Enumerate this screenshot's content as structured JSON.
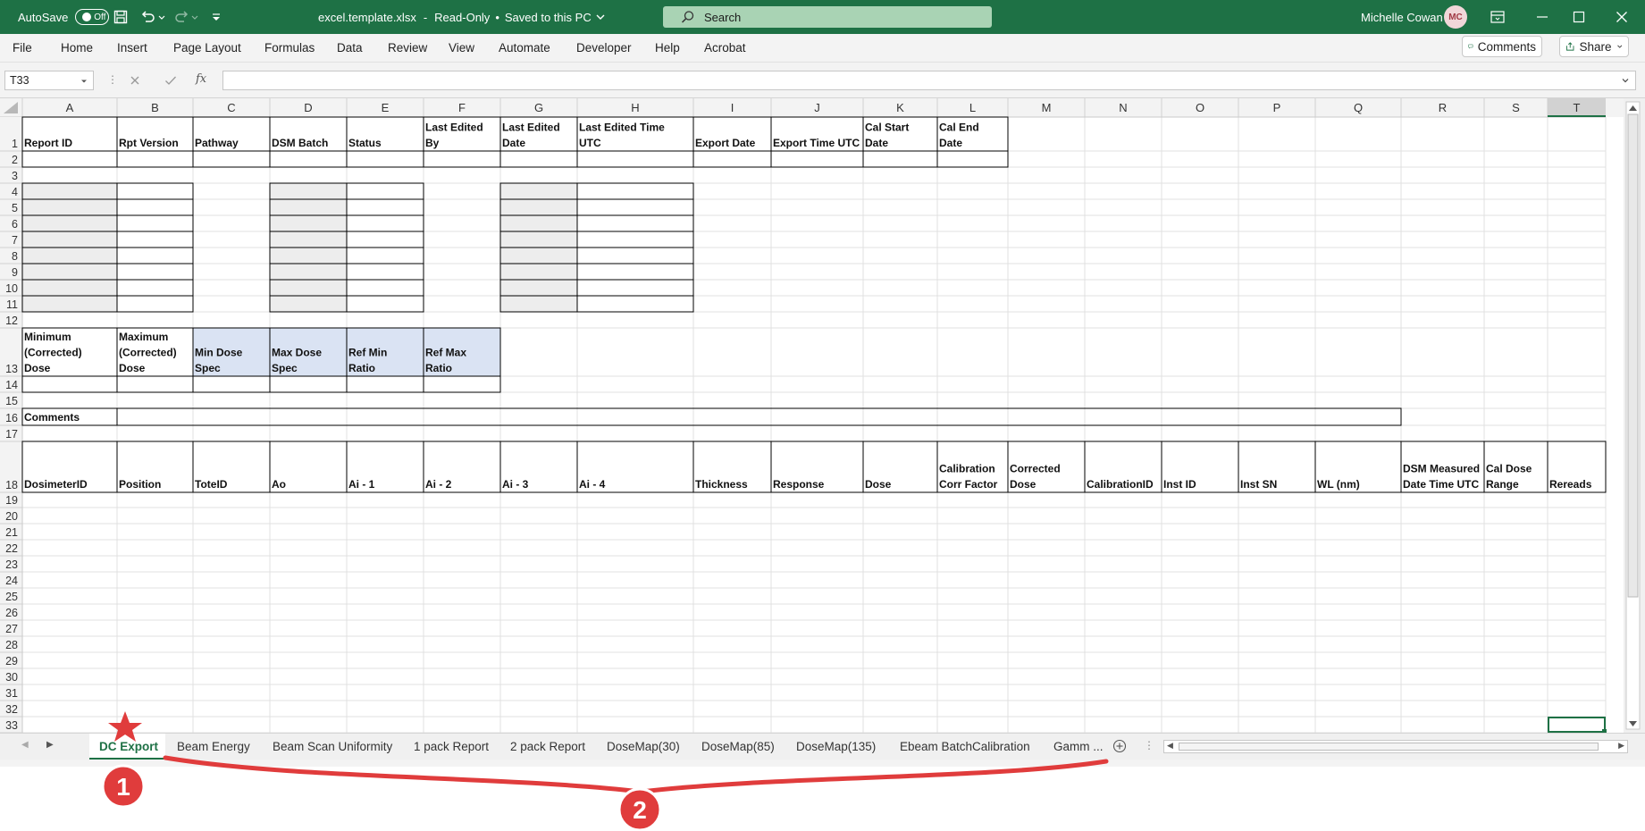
{
  "titlebar": {
    "autosave_label": "AutoSave",
    "autosave_state": "Off",
    "filename": "excel.template.xlsx",
    "status": "Read-Only",
    "saved": "Saved to this PC",
    "search_placeholder": "Search",
    "user_name": "Michelle Cowan",
    "user_initials": "MC"
  },
  "menu": {
    "items": [
      "File",
      "Home",
      "Insert",
      "Page Layout",
      "Formulas",
      "Data",
      "Review",
      "View",
      "Automate",
      "Developer",
      "Help",
      "Acrobat"
    ],
    "comments_label": "Comments",
    "share_label": "Share"
  },
  "formula_bar": {
    "cell_ref": "T33",
    "fx_label": "fx",
    "formula": ""
  },
  "grid": {
    "columns": [
      "A",
      "B",
      "C",
      "D",
      "E",
      "F",
      "G",
      "H",
      "I",
      "J",
      "K",
      "L",
      "M",
      "N",
      "O",
      "P",
      "Q",
      "R",
      "S",
      "T"
    ],
    "rows": [
      "1",
      "2",
      "3",
      "4",
      "5",
      "6",
      "7",
      "8",
      "9",
      "10",
      "11",
      "12",
      "13",
      "14",
      "15",
      "16",
      "17",
      "18",
      "19",
      "20",
      "21",
      "22",
      "23",
      "24",
      "25",
      "26",
      "27",
      "28",
      "29",
      "30",
      "31",
      "32",
      "33"
    ],
    "row1_headers": [
      "Report ID",
      "Rpt Version",
      "Pathway",
      "DSM Batch",
      "Status",
      "Last Edited By",
      "Last Edited Date",
      "Last Edited Time UTC",
      "Export Date",
      "Export Time UTC",
      "Cal Start Date",
      "Cal End Date"
    ],
    "row13_headers": [
      "Minimum (Corrected) Dose",
      "Maximum (Corrected) Dose",
      "Min Dose Spec",
      "Max Dose Spec",
      "Ref Min Ratio",
      "Ref Max Ratio"
    ],
    "row16_label": "Comments",
    "row18_headers": [
      "DosimeterID",
      "Position",
      "ToteID",
      "Ao",
      "Ai - 1",
      "Ai - 2",
      "Ai - 3",
      "Ai - 4",
      "Thickness",
      "Response",
      "Dose",
      "Calibration Corr Factor",
      "Corrected Dose",
      "CalibrationID",
      "Inst ID",
      "Inst SN",
      "WL (nm)",
      "DSM Measured Date Time UTC",
      "Cal Dose Range",
      "Rereads"
    ],
    "colors": {
      "header_bg": "#f3f3f3",
      "gray_fill": "#ededed",
      "blue_fill": "#dae3f3",
      "gridline": "#e1e1e1",
      "border": "#000000",
      "selected": "#1e7145"
    }
  },
  "sheet_tabs": {
    "tabs": [
      "DC Export",
      "Beam Energy",
      "Beam Scan Uniformity",
      "1 pack Report",
      "2 pack Report",
      "DoseMap(30)",
      "DoseMap(85)",
      "DoseMap(135)",
      "Ebeam BatchCalibration",
      "Gamm ..."
    ],
    "active": "DC Export"
  },
  "annotations": {
    "marker1": "1",
    "marker2": "2"
  }
}
